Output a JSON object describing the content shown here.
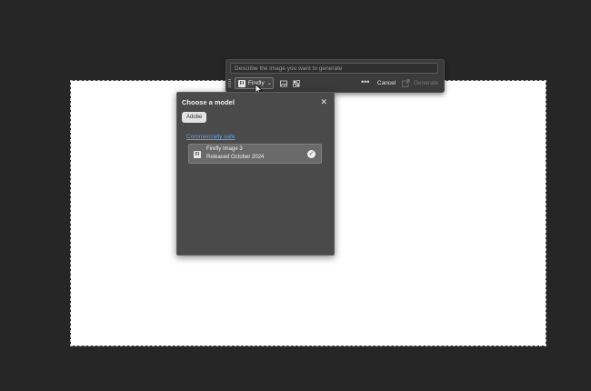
{
  "prompt": {
    "placeholder": "Describe the image you want to generate"
  },
  "toolbar": {
    "model_badge": "FI",
    "model_label": "Firefly",
    "more_label": "•••",
    "cancel_label": "Cancel",
    "generate_label": "Generate"
  },
  "popup": {
    "title": "Choose a model",
    "close_label": "✕",
    "filter_chip": "Adobe",
    "section_label": "Commercially safe",
    "models": [
      {
        "badge": "FI",
        "name": "Firefly Image 3",
        "released": "Released October 2024",
        "selected": true
      }
    ]
  },
  "icons": [
    "grip-icon",
    "chevron-down-icon",
    "image-reference-icon",
    "style-reference-icon",
    "more-icon",
    "generate-icon",
    "cursor-icon",
    "close-icon",
    "checkmark-icon"
  ],
  "colors": {
    "background": "#262626",
    "canvas": "#ffffff",
    "panel": "#4a4a4a",
    "link": "#4ea6ff"
  }
}
